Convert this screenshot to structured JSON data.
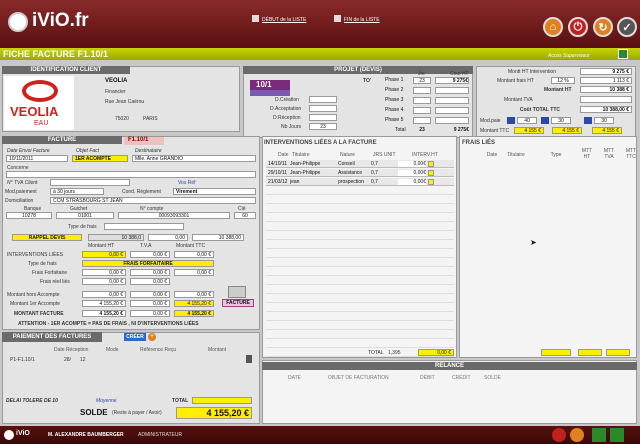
{
  "app": {
    "logo": "iViO.fr",
    "debut": "DÉBUT de la LISTE",
    "fin": "FIN de la LISTE",
    "title": "FICHE FACTURE F1.10/1",
    "acces": "Accès Superviseur"
  },
  "client": {
    "header": "IDENTIFICATION CLIENT",
    "brand": "VEOLIA",
    "brand_sub": "EAU",
    "name": "VEOLIA",
    "l2": "Financier",
    "l3": "Rue Jean Caërou",
    "cp": "75020",
    "ville": "PARIS"
  },
  "projet": {
    "header": "PROJET (DEVIS)",
    "num": "10/1",
    "to": "TO'",
    "creation": "D.Création",
    "acceptation": "D.Acceptation",
    "reception": "D.Réception",
    "nbjours_label": "Nb Jours",
    "nbjours": "23",
    "jrs": "Jrs",
    "couthead": "Cout HT",
    "phases": [
      {
        "l": "Phase 1",
        "j": "23",
        "c": "9 275€"
      },
      {
        "l": "Phase 2",
        "j": "",
        "c": ""
      },
      {
        "l": "Phase 3",
        "j": "",
        "c": ""
      },
      {
        "l": "Phase 4",
        "j": "",
        "c": ""
      },
      {
        "l": "Phase 5",
        "j": "",
        "c": ""
      }
    ],
    "total_label": "Total",
    "total_j": "23",
    "total_c": "9 275€"
  },
  "montants": {
    "mi_label": "Montt HT Intervention",
    "mi": "9 275 €",
    "mf_label": "Montant frais HT",
    "mf_pct": "12 %",
    "mf": "1 113 €",
    "mht_label": "Montant HT",
    "mht": "10 388 €",
    "mtva_label": "Montant TVA",
    "mtva": "",
    "ctt_label": "Coût TOTAL TTC",
    "ctt": "10 388,00 €",
    "modpaie_label": "Mod.paie",
    "mp1": "40",
    "mp2": "30",
    "mp3": "30",
    "mttc_label": "Montant TTC",
    "mttc1": "4 155 €",
    "mttc2": "4 155 €",
    "mttc3": "4 155 €"
  },
  "facture": {
    "header": "FACTURE",
    "num": "F1.10/1",
    "date_lbl": "Date Envoi Facture",
    "objet_lbl": "Objet Fact",
    "dest_lbl": "Destinataire",
    "date": "10/11/2011",
    "objet": "1ER ACOMPTE",
    "dest": "Mlle. Anne GRANDIO",
    "concerne": "Concerne",
    "tva_lbl": "N° TVA Client",
    "vosref": "Vos Réf",
    "modpaie_lbl": "Mod.paiement",
    "modpaie": "à 30 jours",
    "cond_lbl": "Cond. Règlement",
    "cond": "Virement",
    "domi_lbl": "Domiciliation",
    "domi": "CCM STRASBOURG ST JEAN",
    "banque_lbl": "Banque",
    "guichet_lbl": "Guichet",
    "compte_lbl": "N° compte",
    "cle_lbl": "Clé",
    "banque": "10278",
    "guichet": "01001",
    "compte": "00093093301",
    "cle": "60",
    "typefrais_lbl": "Type de frais",
    "rappel": "RAPPEL DEVIS",
    "rappel_v1": "10 388,0",
    "rappel_v2": "0,00",
    "rappel_v3": "10 388,00",
    "mht": "Montant HT",
    "tva": "T.V.A",
    "mttc": "Montant TTC",
    "il_lbl": "INTERVENTIONS LIÉES",
    "il1": "0,00 €",
    "il2": "0,00 €",
    "il3": "0,00 €",
    "typefrais2": "Type de frais",
    "fraisf": "FRAIS FORFAITAIRE",
    "ff_lbl": "Frais Forfaitaire",
    "ff1": "0,00 €",
    "ff2": "0,00 €",
    "ff3": "0,00 €",
    "frl_lbl": "Frais réel liés",
    "frl1": "0,00 €",
    "frl2": "0,00 €",
    "mha_lbl": "Montant hors Accompte",
    "mha1": "0,00 €",
    "mha2": "0,00 €",
    "mha3": "0,00 €",
    "m1a_lbl": "Montant 1er Accompte",
    "m1a1": "4 155,20 €",
    "m1a2": "0,00 €",
    "m1a3": "4 155,20 €",
    "mf_lbl": "MONTANT FACTURE",
    "mf1": "4 155,20 €",
    "mf2": "0,00 €",
    "mf3": "4 155,20 €",
    "print": "FACTURE",
    "attention": "ATTENTION - 1ER ACOMPTE = PAS DE FRAIS , NI D'INTERVENTIONS LIÉES"
  },
  "interv": {
    "header": "INTERVENTIONS LIÉES A LA FACTURE",
    "cols": [
      "Date",
      "Titulaire",
      "Nature",
      "JRS UNIT",
      "INTERV.HT"
    ],
    "rows": [
      {
        "d": "14/10/11",
        "t": "Jean-Philippe",
        "n": "Conseil",
        "j": "0,7",
        "v": "0,00€"
      },
      {
        "d": "29/10/11",
        "t": "Jean-Philippe",
        "n": "Assistance",
        "j": "0,7",
        "v": "0,00€"
      },
      {
        "d": "21/03/12",
        "t": "jean",
        "n": "prospection",
        "j": "0,7",
        "v": "0,00€"
      }
    ],
    "total_lbl": "TOTAL",
    "total_j": "1,395",
    "total_v": "0,00 €"
  },
  "frais": {
    "header": "FRAIS LIÉS",
    "cols": [
      "Date",
      "Titulaire",
      "Type",
      "MTT HT",
      "MTT TVA",
      "MTT TTC"
    ]
  },
  "paiement": {
    "header": "PAIEMENT DES FACTURES",
    "creer": "CRÉER",
    "cols": [
      "Date Réception",
      "Mode",
      "Référence Reçu",
      "Montant"
    ],
    "row": {
      "n": "P1-F1.10/1",
      "d": "28/",
      "m": "12"
    },
    "delai": "DELAI TOLERE DE 10",
    "moyenne": "Moyenne",
    "total": "TOTAL",
    "solde": "SOLDE",
    "solde_sub": "(Reste à payer / Avoir)",
    "solde_v": "4 155,20 €"
  },
  "relance": {
    "header": "RELANCE",
    "cols": [
      "DATE",
      "OBJET DE FACTURATION",
      "DÉBIT",
      "CRÉDIT",
      "SOLDE"
    ]
  },
  "footer": {
    "logo": "iViO",
    "user": "M. ALEXANDRE BAUMBERGER",
    "role": "ADMINISTRATEUR"
  }
}
